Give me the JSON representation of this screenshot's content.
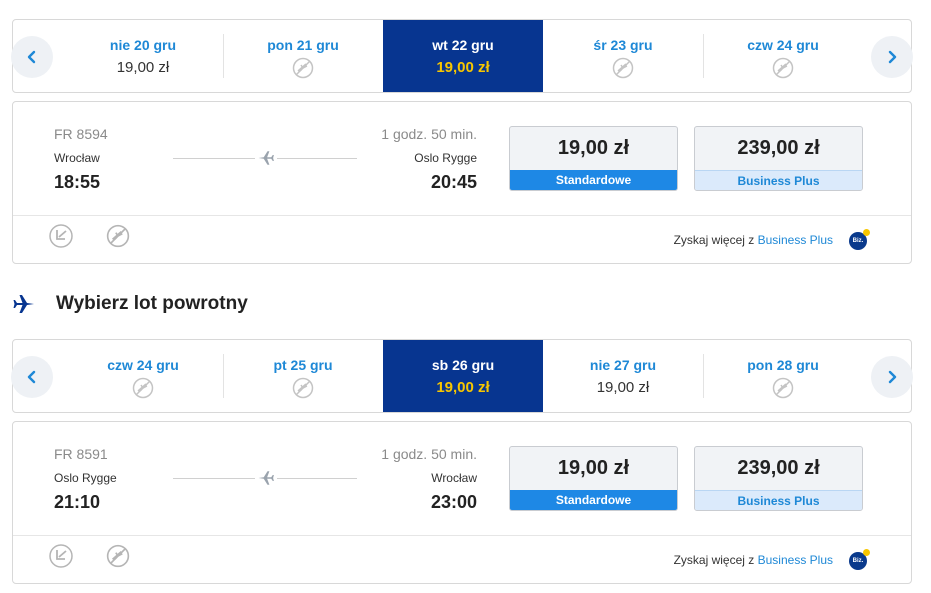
{
  "outbound": {
    "dates": [
      {
        "label": "nie 20 gru",
        "price": "19,00 zł",
        "available": true,
        "active": false
      },
      {
        "label": "pon 21 gru",
        "price": "",
        "available": false,
        "active": false
      },
      {
        "label": "wt 22 gru",
        "price": "19,00 zł",
        "available": true,
        "active": true
      },
      {
        "label": "śr 23 gru",
        "price": "",
        "available": false,
        "active": false
      },
      {
        "label": "czw 24 gru",
        "price": "",
        "available": false,
        "active": false
      }
    ],
    "flight": {
      "number": "FR 8594",
      "dep_city": "Wrocław",
      "dep_time": "18:55",
      "duration": "1 godz. 50 min.",
      "arr_city": "Oslo Rygge",
      "arr_time": "20:45",
      "fare_standard": {
        "amount": "19,00 zł",
        "name": "Standardowe"
      },
      "fare_business": {
        "amount": "239,00 zł",
        "name": "Business Plus"
      },
      "promo_text": "Zyskaj więcej z",
      "promo_link": "Business Plus",
      "badge": "Biz."
    }
  },
  "return_section": {
    "title": "Wybierz lot powrotny"
  },
  "return": {
    "dates": [
      {
        "label": "czw 24 gru",
        "price": "",
        "available": false,
        "active": false
      },
      {
        "label": "pt 25 gru",
        "price": "",
        "available": false,
        "active": false
      },
      {
        "label": "sb 26 gru",
        "price": "19,00 zł",
        "available": true,
        "active": true
      },
      {
        "label": "nie 27 gru",
        "price": "19,00 zł",
        "available": true,
        "active": false
      },
      {
        "label": "pon 28 gru",
        "price": "",
        "available": false,
        "active": false
      }
    ],
    "flight": {
      "number": "FR 8591",
      "dep_city": "Oslo Rygge",
      "dep_time": "21:10",
      "duration": "1 godz. 50 min.",
      "arr_city": "Wrocław",
      "arr_time": "23:00",
      "fare_standard": {
        "amount": "19,00 zł",
        "name": "Standardowe"
      },
      "fare_business": {
        "amount": "239,00 zł",
        "name": "Business Plus"
      },
      "promo_text": "Zyskaj więcej z",
      "promo_link": "Business Plus",
      "badge": "Biz."
    }
  },
  "icons": {
    "prev": "chevron-left-icon",
    "next": "chevron-right-icon",
    "no_flight": "no-flight-icon",
    "plane": "plane-icon",
    "priority": "priority-boarding-icon",
    "amenity_disabled": "no-flight-icon"
  },
  "colors": {
    "brand_blue": "#073590",
    "accent_yellow": "#f7c600",
    "link_blue": "#1e88d6",
    "fare_blue": "#1e88e5"
  }
}
